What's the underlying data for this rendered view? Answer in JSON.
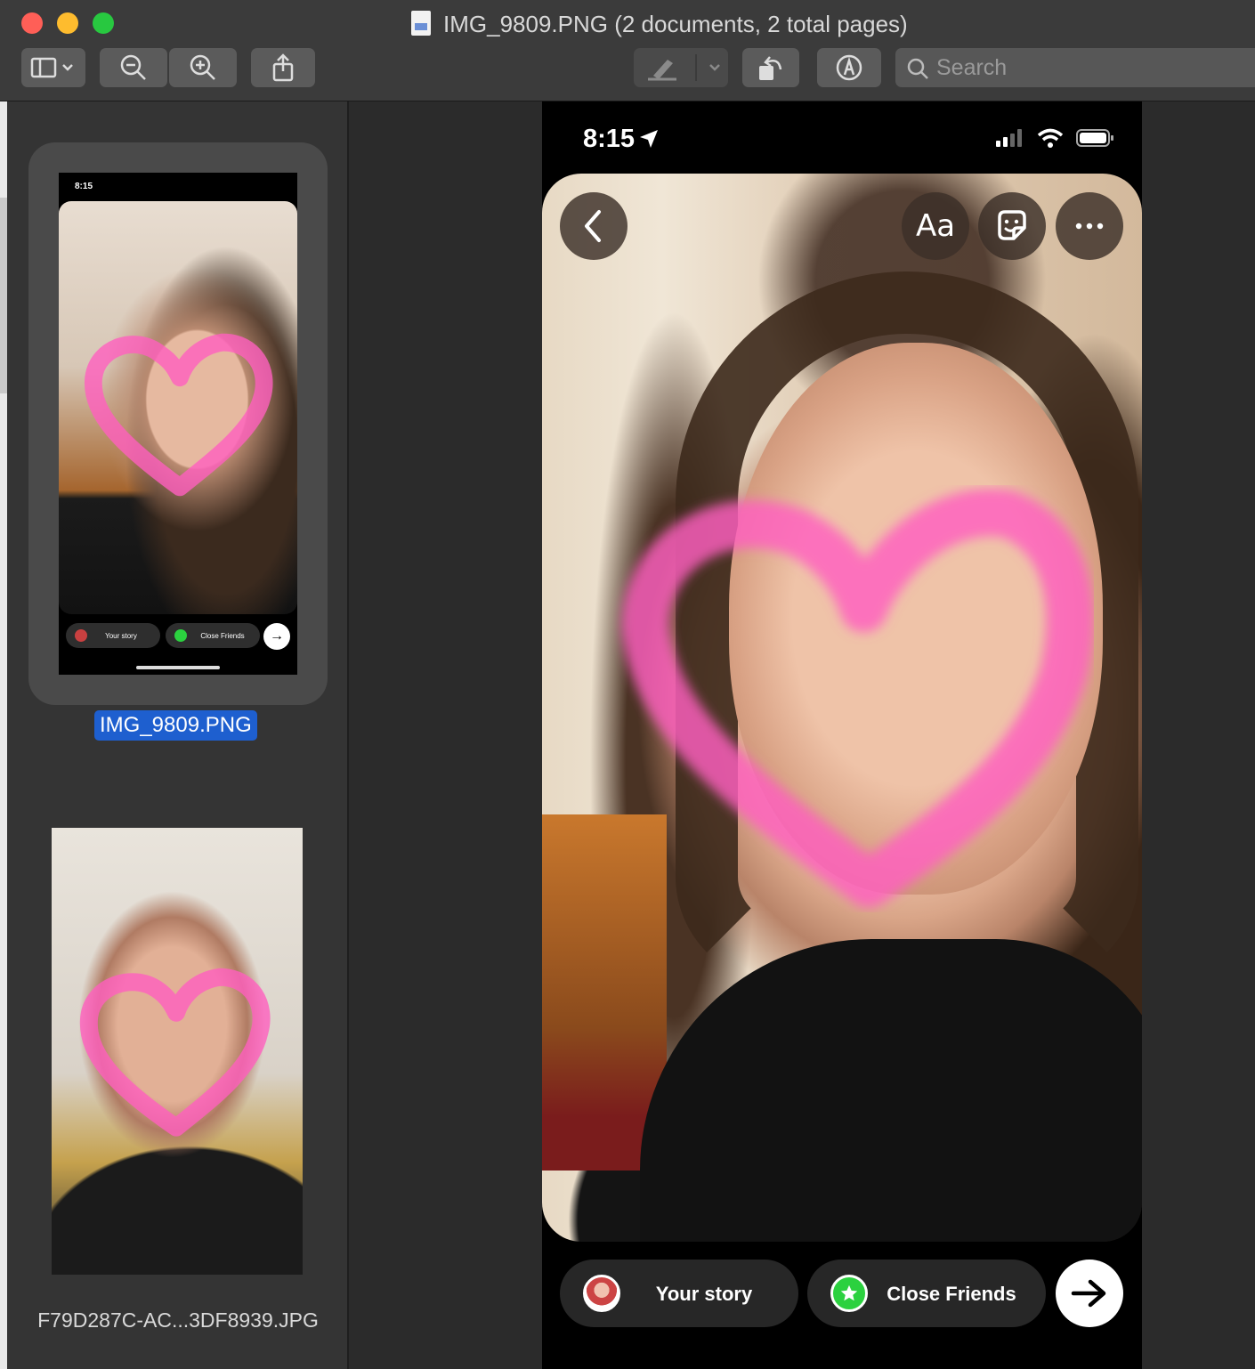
{
  "window": {
    "title": "IMG_9809.PNG (2 documents, 2 total pages)"
  },
  "toolbar": {
    "search_placeholder": "Search",
    "buttons": [
      "sidebar-toggle-icon",
      "zoom-out-icon",
      "zoom-in-icon",
      "share-icon",
      "highlight-pen-icon",
      "rotate-icon",
      "markup-icon"
    ]
  },
  "sidebar": {
    "items": [
      {
        "filename": "IMG_9809.PNG",
        "selected": true
      },
      {
        "filename": "F79D287C-AC...3DF8939.JPG",
        "selected": false
      }
    ],
    "mini": {
      "time": "8:15",
      "story_label": "Your story",
      "friends_label": "Close Friends"
    }
  },
  "phone": {
    "time": "8:15",
    "text_tool_label": "Aa",
    "story_label": "Your story",
    "friends_label": "Close Friends",
    "icons": [
      "location-arrow-icon",
      "signal-icon",
      "wifi-icon",
      "battery-icon",
      "back-chevron-icon",
      "sticker-icon",
      "more-icon",
      "arrow-right-icon",
      "star-icon"
    ]
  },
  "colors": {
    "selection": "#1e5fcf",
    "heart": "#ff5fbf",
    "close_friends": "#2bd13f"
  }
}
